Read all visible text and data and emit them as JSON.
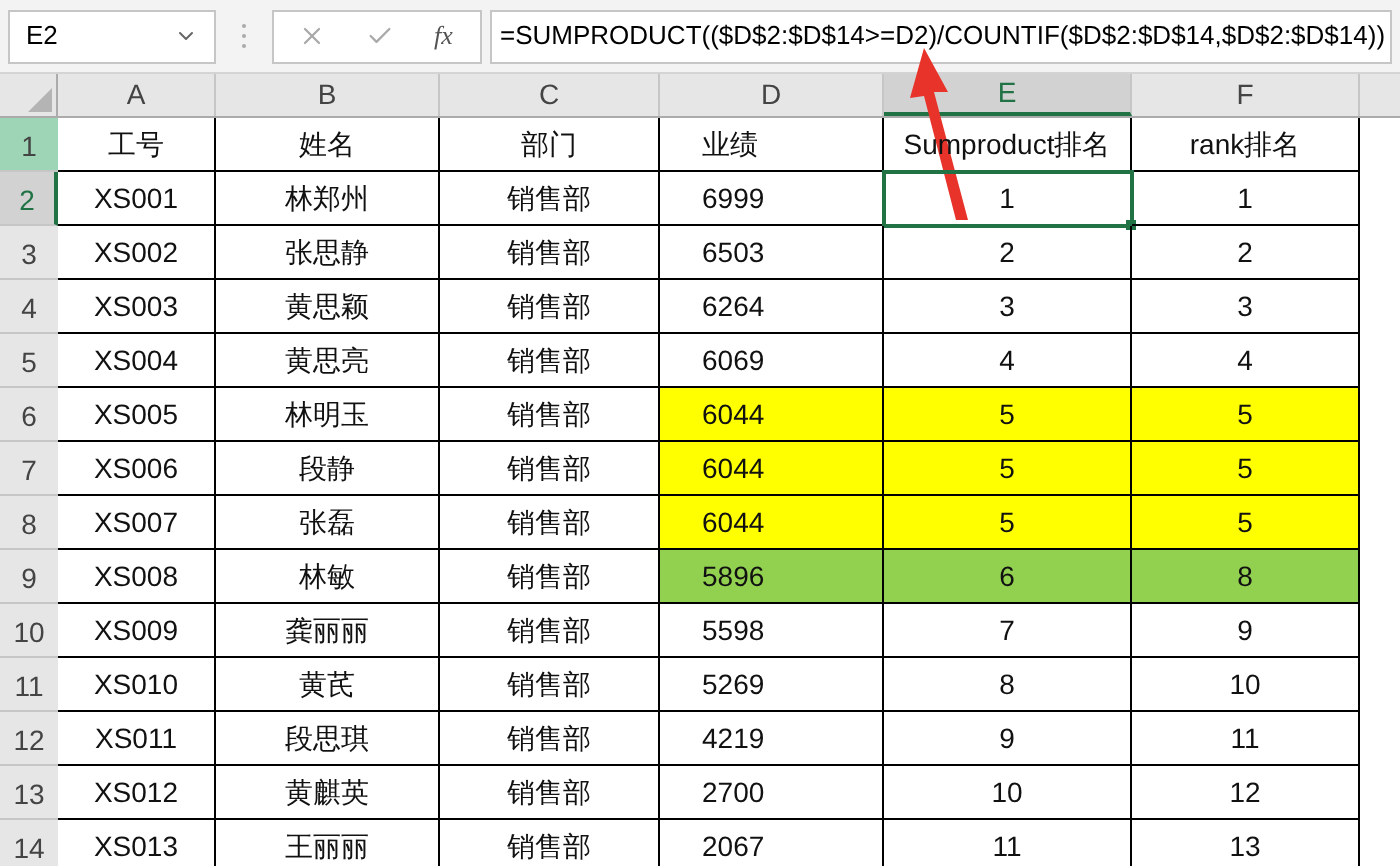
{
  "name_box": {
    "value": "E2"
  },
  "formula_bar": {
    "function_label": "fx",
    "value": "=SUMPRODUCT(($D$2:$D$14>=D2)/COUNTIF($D$2:$D$14,$D$2:$D$14))"
  },
  "columns": [
    {
      "label": "A",
      "selected": false
    },
    {
      "label": "B",
      "selected": false
    },
    {
      "label": "C",
      "selected": false
    },
    {
      "label": "D",
      "selected": false
    },
    {
      "label": "E",
      "selected": true
    },
    {
      "label": "F",
      "selected": false
    }
  ],
  "rows": [
    {
      "number": "1",
      "highlighted": true,
      "selected": false,
      "cells": [
        "工号",
        "姓名",
        "部门",
        "业绩",
        "Sumproduct排名",
        "rank排名"
      ]
    },
    {
      "number": "2",
      "highlighted": false,
      "selected": true,
      "cells": [
        "XS001",
        "林郑州",
        "销售部",
        "6999",
        "1",
        "1"
      ]
    },
    {
      "number": "3",
      "highlighted": false,
      "selected": false,
      "cells": [
        "XS002",
        "张思静",
        "销售部",
        "6503",
        "2",
        "2"
      ]
    },
    {
      "number": "4",
      "highlighted": false,
      "selected": false,
      "cells": [
        "XS003",
        "黄思颖",
        "销售部",
        "6264",
        "3",
        "3"
      ]
    },
    {
      "number": "5",
      "highlighted": false,
      "selected": false,
      "cells": [
        "XS004",
        "黄思亮",
        "销售部",
        "6069",
        "4",
        "4"
      ]
    },
    {
      "number": "6",
      "highlighted": false,
      "selected": false,
      "color": "#ffff00",
      "cells": [
        "XS005",
        "林明玉",
        "销售部",
        "6044",
        "5",
        "5"
      ]
    },
    {
      "number": "7",
      "highlighted": false,
      "selected": false,
      "color": "#ffff00",
      "cells": [
        "XS006",
        "段静",
        "销售部",
        "6044",
        "5",
        "5"
      ]
    },
    {
      "number": "8",
      "highlighted": false,
      "selected": false,
      "color": "#ffff00",
      "cells": [
        "XS007",
        "张磊",
        "销售部",
        "6044",
        "5",
        "5"
      ]
    },
    {
      "number": "9",
      "highlighted": false,
      "selected": false,
      "color": "#92d050",
      "cells": [
        "XS008",
        "林敏",
        "销售部",
        "5896",
        "6",
        "8"
      ]
    },
    {
      "number": "10",
      "highlighted": false,
      "selected": false,
      "cells": [
        "XS009",
        "龚丽丽",
        "销售部",
        "5598",
        "7",
        "9"
      ]
    },
    {
      "number": "11",
      "highlighted": false,
      "selected": false,
      "cells": [
        "XS010",
        "黄芪",
        "销售部",
        "5269",
        "8",
        "10"
      ]
    },
    {
      "number": "12",
      "highlighted": false,
      "selected": false,
      "cells": [
        "XS011",
        "段思琪",
        "销售部",
        "4219",
        "9",
        "11"
      ]
    },
    {
      "number": "13",
      "highlighted": false,
      "selected": false,
      "cells": [
        "XS012",
        "黄麒英",
        "销售部",
        "2700",
        "10",
        "12"
      ]
    },
    {
      "number": "14",
      "highlighted": false,
      "selected": false,
      "cells": [
        "XS013",
        "王丽丽",
        "销售部",
        "2067",
        "11",
        "13"
      ]
    }
  ]
}
